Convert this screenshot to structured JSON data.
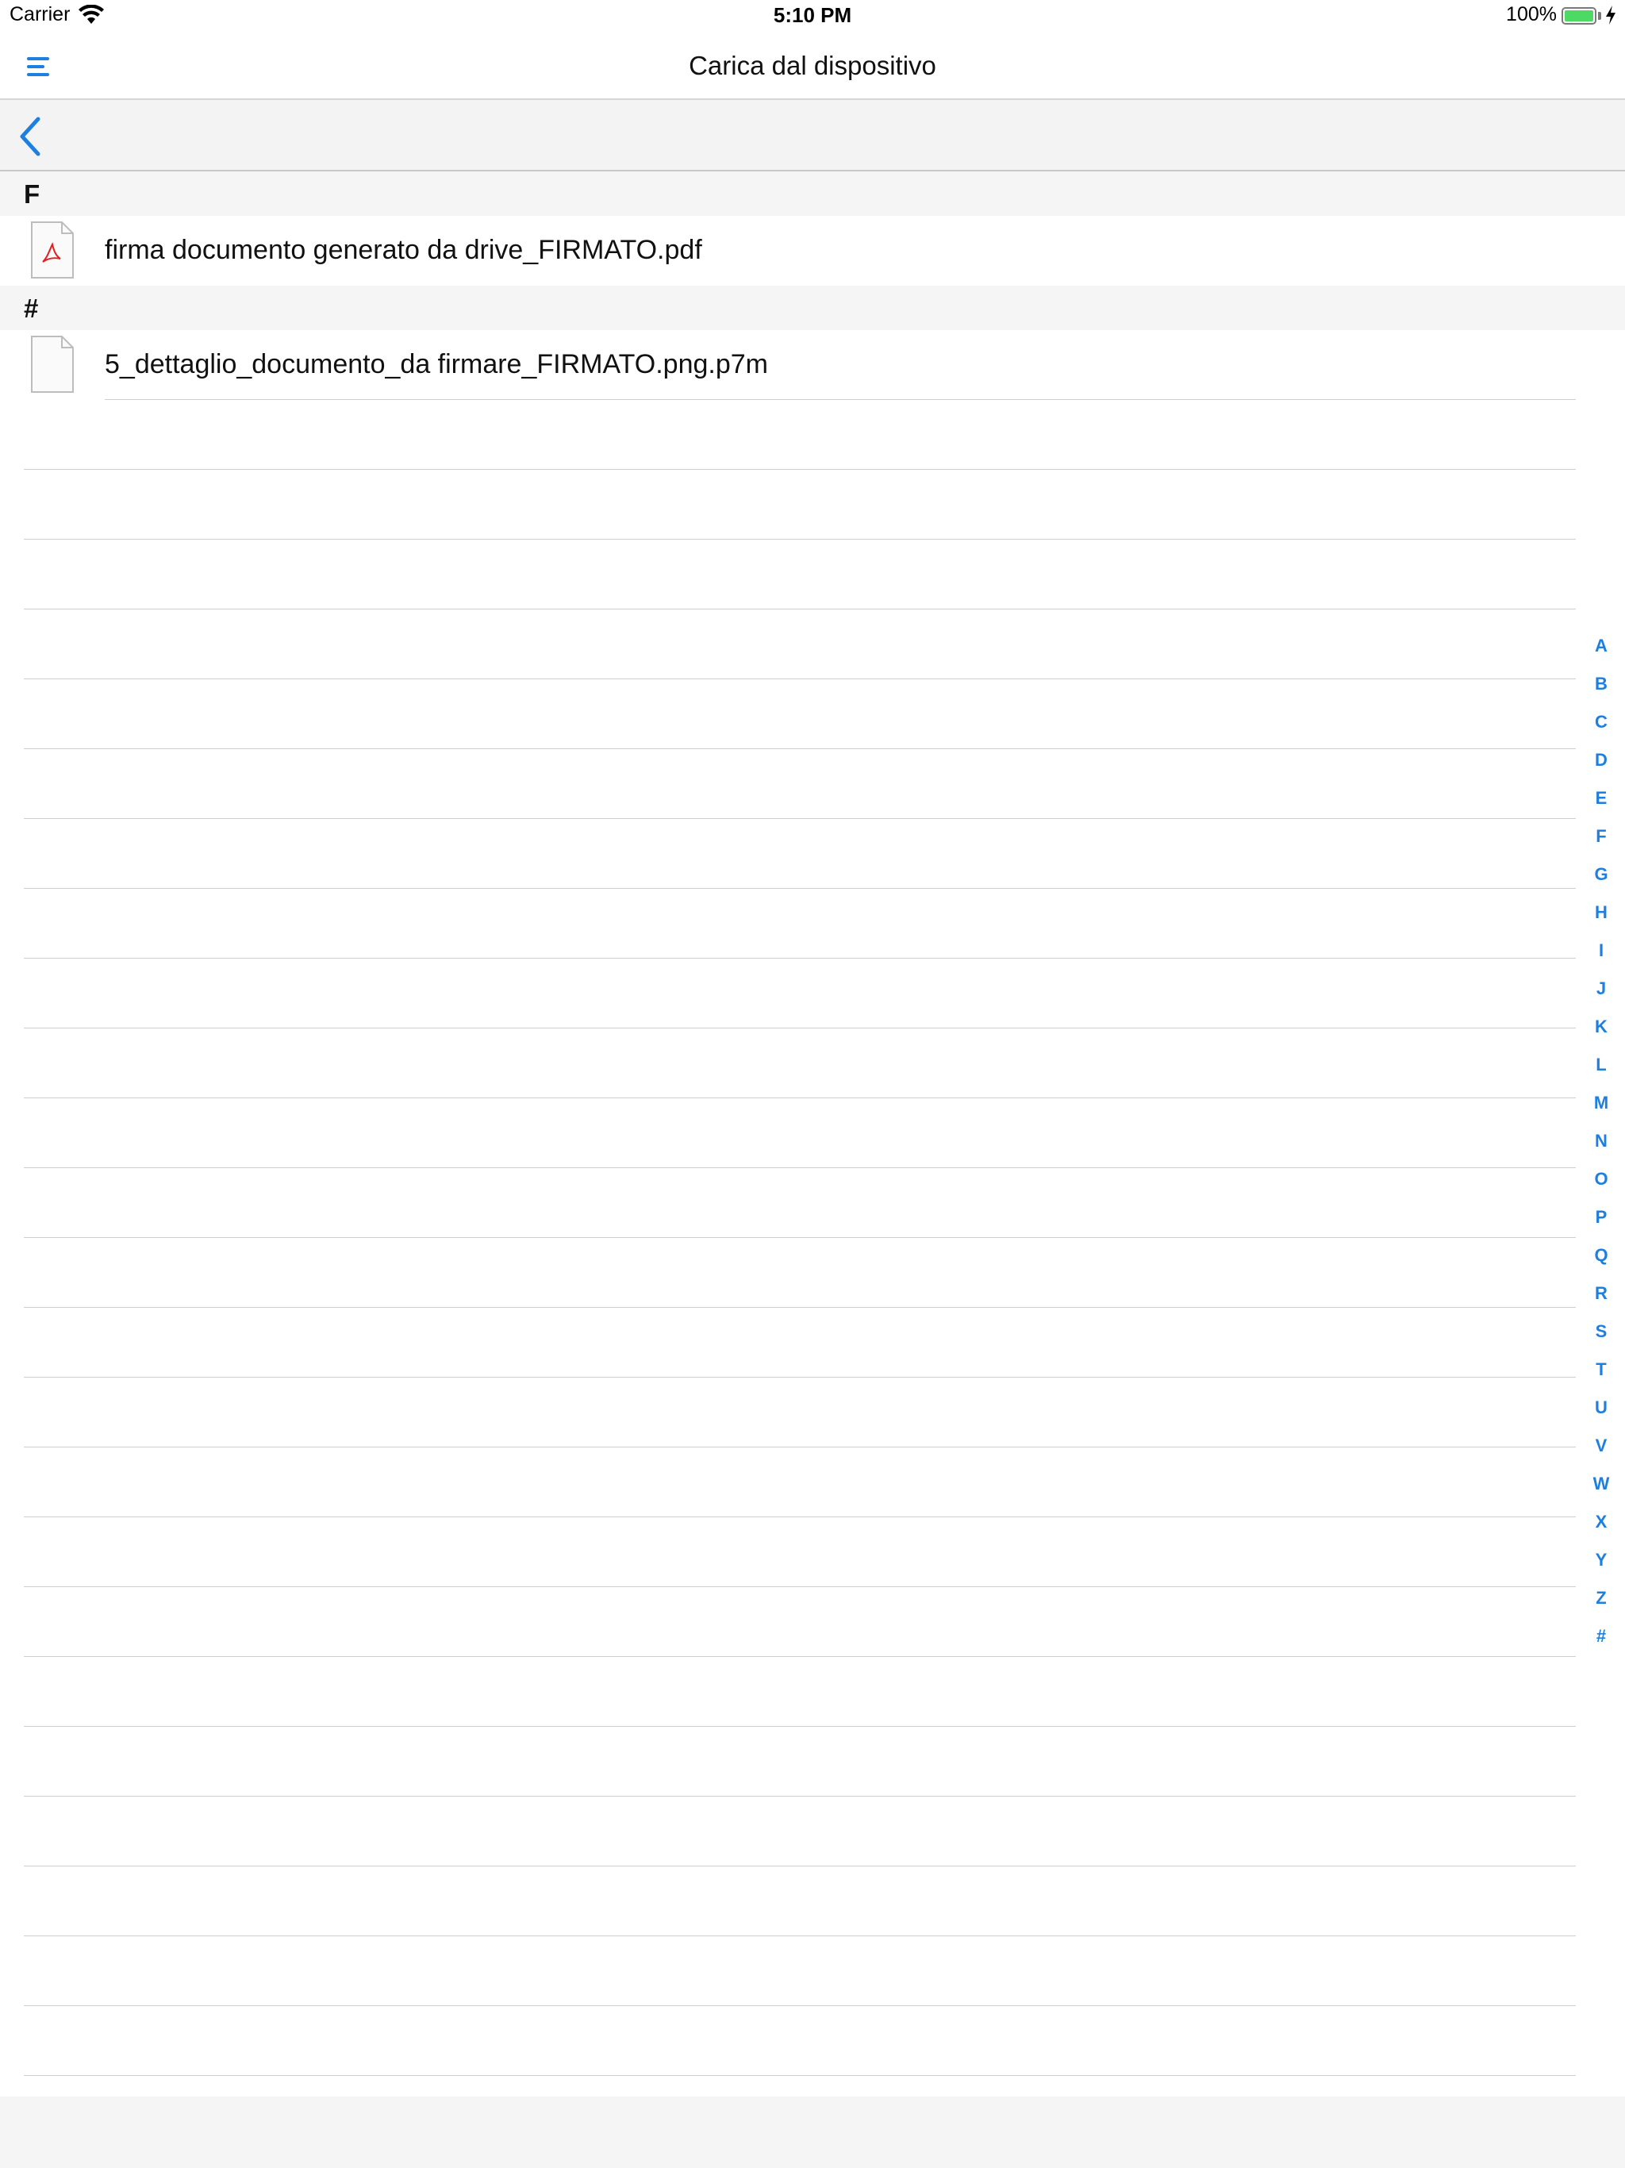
{
  "status_bar": {
    "carrier": "Carrier",
    "time": "5:10 PM",
    "battery_percent": "100%",
    "battery_level": 1.0,
    "icons": [
      "wifi-icon",
      "battery-icon",
      "charging-bolt-icon"
    ]
  },
  "nav": {
    "title": "Carica dal dispositivo",
    "menu_icon": "hamburger-menu-icon"
  },
  "toolbar": {
    "back_icon": "chevron-left-icon"
  },
  "sections": [
    {
      "header": "F",
      "files": [
        {
          "name": "firma documento generato da drive_FIRMATO.pdf",
          "icon": "pdf-file-icon"
        }
      ]
    },
    {
      "header": "#",
      "files": [
        {
          "name": "5_dettaglio_documento_da firmare_FIRMATO.png.p7m",
          "icon": "generic-file-icon"
        }
      ]
    }
  ],
  "index": [
    "A",
    "B",
    "C",
    "D",
    "E",
    "F",
    "G",
    "H",
    "I",
    "J",
    "K",
    "L",
    "M",
    "N",
    "O",
    "P",
    "Q",
    "R",
    "S",
    "T",
    "U",
    "V",
    "W",
    "X",
    "Y",
    "Z",
    "#"
  ],
  "colors": {
    "accent": "#1d7fe0",
    "pdf_red": "#e02020",
    "battery_green": "#4cd964",
    "header_bg": "#f5f5f5",
    "separator": "#cfcfcf"
  }
}
